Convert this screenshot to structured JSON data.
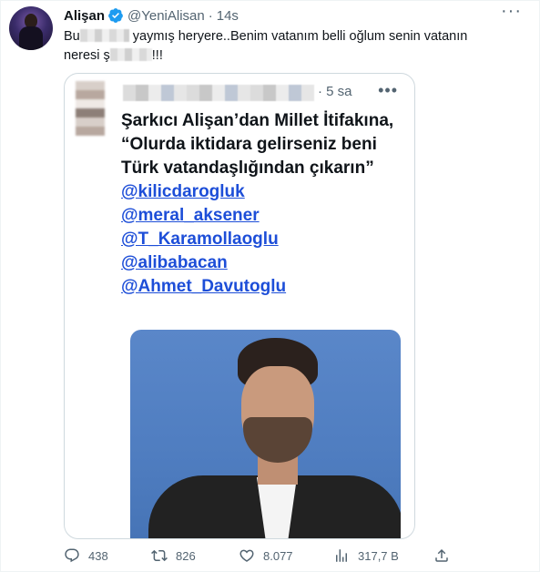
{
  "author": {
    "name": "Alişan",
    "handle": "@YeniAlisan",
    "separator": "·",
    "time": "14s"
  },
  "tweet": {
    "line1_start": "Bu",
    "line1_end": "yaymış heryere..Benim vatanım belli oğlum senin vatanın",
    "line2_start": "neresi ş",
    "line2_end": "!!!"
  },
  "quoted": {
    "time": "· 5 sa",
    "headline": "Şarkıcı Alişan’dan Millet İtifakına,  “Olurda iktidara gelirseniz beni Türk vatandaşlığından çıkarın”",
    "mentions": [
      "@kilicdarogluk",
      "@meral_aksener",
      "@T_Karamollaoglu",
      "@alibabacan",
      "@Ahmet_Davutoglu"
    ]
  },
  "actions": {
    "replies": "438",
    "retweets": "826",
    "likes": "8.077",
    "views": "317,7 B"
  },
  "icons": {
    "verified": "verified-badge-icon",
    "more": "more-icon",
    "reply": "reply-icon",
    "retweet": "retweet-icon",
    "like": "heart-icon",
    "views": "views-icon",
    "share": "share-icon"
  },
  "colors": {
    "accent": "#1d9bf0",
    "muted": "#536471",
    "mention": "#1d4ed8"
  }
}
